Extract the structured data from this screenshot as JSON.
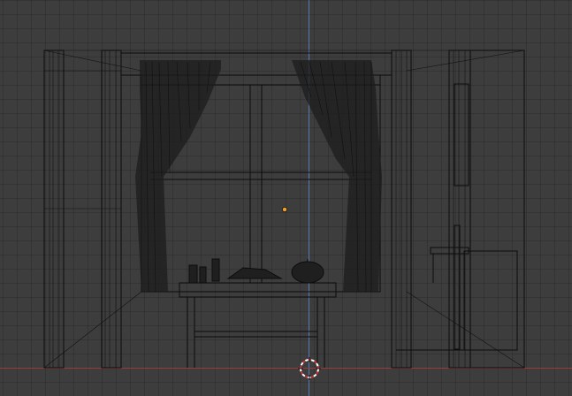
{
  "viewport": {
    "background": "#3d3d3d",
    "grid_color": "#353535",
    "z_axis_color": "#5e86c8",
    "x_axis_color": "#9a3a3a",
    "wire_color": "#0c0c0c",
    "origin_color": "#f0a030"
  },
  "scene": {
    "objects": [
      "left-wall-columns",
      "right-wall-columns",
      "window-frame",
      "left-curtain",
      "right-curtain",
      "table",
      "table-items",
      "kettle",
      "door",
      "stove-chair"
    ],
    "icons": {
      "origin": "origin-dot-icon",
      "cursor": "3d-cursor-icon"
    }
  }
}
